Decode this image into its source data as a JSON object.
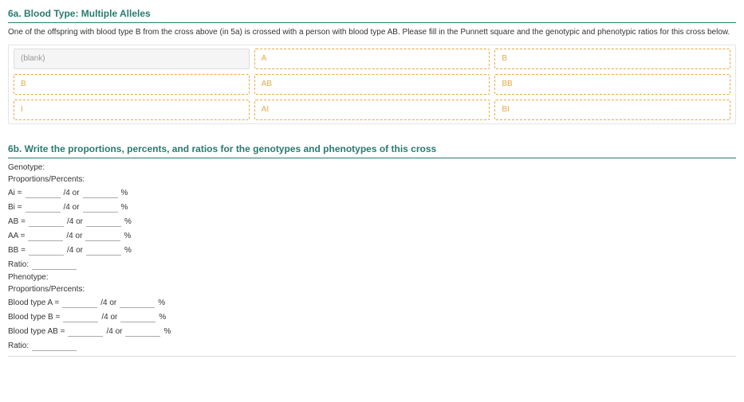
{
  "section6a": {
    "title": "6a. Blood Type: Multiple Alleles",
    "instruction": "One of the offspring with blood type B from the cross above (in 5a) is crossed with a person with blood type AB. Please fill in the Punnett square and the genotypic and phenotypic ratios for this cross below.",
    "punnett": {
      "header": [
        "(blank)",
        "A",
        "B"
      ],
      "rows": [
        {
          "side": "B",
          "cells": [
            "AB",
            "BB"
          ]
        },
        {
          "side": "I",
          "cells": [
            "AI",
            "BI"
          ]
        }
      ]
    }
  },
  "section6b": {
    "title": "6b. Write the proportions, percents, and ratios for the genotypes and phenotypes of this cross",
    "genotype": {
      "heading": "Genotype:",
      "subheading": "Proportions/Percents:",
      "lines": [
        {
          "label": "Ai =",
          "mid": "/4 or",
          "end": "%"
        },
        {
          "label": "Bi =",
          "mid": "/4 or",
          "end": "%"
        },
        {
          "label": "AB =",
          "mid": "/4 or",
          "end": "%"
        },
        {
          "label": "AA =",
          "mid": "/4 or",
          "end": "%"
        },
        {
          "label": "BB =",
          "mid": "/4 or",
          "end": "%"
        }
      ],
      "ratio_label": "Ratio:"
    },
    "phenotype": {
      "heading": "Phenotype:",
      "subheading": "Proportions/Percents:",
      "lines": [
        {
          "label": "Blood type A =",
          "mid": "/4 or",
          "end": "%"
        },
        {
          "label": "Blood type B =",
          "mid": "/4 or",
          "end": "%"
        },
        {
          "label": "Blood type AB =",
          "mid": "/4 or",
          "end": "%"
        }
      ],
      "ratio_label": "Ratio:"
    }
  }
}
